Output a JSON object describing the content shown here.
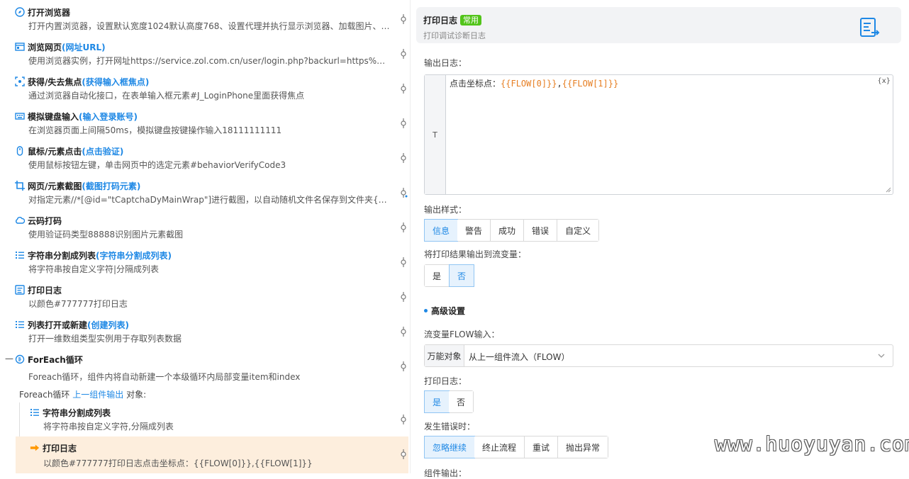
{
  "steps": [
    {
      "icon": "compass-icon",
      "title": "打开浏览器",
      "alias": "",
      "desc": "打开内置浏览器，设置默认宽度1024默认高度768、设置代理并执行显示浏览器、加载图片、…"
    },
    {
      "icon": "browser-window-icon",
      "title": "浏览网页",
      "alias": "(网址URL)",
      "desc": "使用浏览器实例，打开网址https://service.zol.com.cn/user/login.php?backurl=https%3A%2F%…"
    },
    {
      "icon": "focus-icon",
      "title": "获得/失去焦点",
      "alias": "(获得输入框焦点)",
      "desc": "通过浏览器自动化接口，在表单输入框元素#J_LoginPhone里面获得焦点"
    },
    {
      "icon": "keyboard-icon",
      "title": "模拟键盘输入",
      "alias": "(输入登录账号)",
      "desc": "在浏览器页面上间隔50ms，模拟键盘按键操作输入18111111111"
    },
    {
      "icon": "mouse-icon",
      "title": "鼠标/元素点击",
      "alias": "(点击验证)",
      "desc": "使用鼠标按钮左键，单击网页中的选定元素#behaviorVerifyCode3"
    },
    {
      "icon": "crop-icon",
      "title": "网页/元素截图",
      "alias": "(截图打码元素)",
      "desc": "对指定元素//*[@id=\"tCaptchaDyMainWrap\"]进行截图，以自动随机文件名保存到文件夹{{ENV.…"
    },
    {
      "icon": "cloud-icon",
      "title": "云码打码",
      "alias": "",
      "desc": "使用验证码类型88888识别图片元素截图"
    },
    {
      "icon": "list-icon",
      "title": "字符串分割成列表",
      "alias": "(字符串分割成列表)",
      "desc": "将字符串按自定义字符|分隔成列表"
    },
    {
      "icon": "print-log-icon",
      "title": "打印日志",
      "alias": "",
      "desc": "以颜色#777777打印日志"
    },
    {
      "icon": "list-icon",
      "title": "列表打开或新建",
      "alias": "(创建列表)",
      "desc": "打开一维数组类型实例用于存取列表数据"
    },
    {
      "icon": "loop-icon",
      "title": "ForEach循环",
      "alias": "",
      "desc": "Foreach循环，组件内将自动新建一个本级循环内局部变量item和index"
    }
  ],
  "collapse_symbol": "—",
  "foreach_sub": {
    "prefix": "Foreach循环",
    "link": "上一组件输出",
    "suffix": "对象:"
  },
  "nested": [
    {
      "icon": "list-icon",
      "title": "字符串分割成列表",
      "desc": "将字符串按自定义字符,分隔成列表"
    },
    {
      "icon": "arrow-right-icon",
      "title": "打印日志",
      "desc": "以颜色#777777打印日志点击坐标点：{{FLOW[0]}},{{FLOW[1]}}"
    }
  ],
  "panel": {
    "title": "打印日志",
    "badge": "常用",
    "subtitle": "打印调试诊断日志",
    "output_log_label": "输出日志：",
    "log_prefix": "点击坐标点：",
    "log_var1": "{{FLOW[0]}}",
    "log_sep": ",",
    "log_var2": "{{FLOW[1]}}",
    "t_label": "T",
    "x_button": "{x}",
    "style_label": "输出样式：",
    "style_options": [
      "信息",
      "警告",
      "成功",
      "错误",
      "自定义"
    ],
    "style_selected": "信息",
    "to_var_label": "将打印结果输出到流变量：",
    "to_var_options": [
      "是",
      "否"
    ],
    "to_var_selected": "否",
    "advanced_label": "高级设置",
    "flow_input_label": "流变量FLOW输入：",
    "flow_prefix": "万能对象",
    "flow_value": "从上一组件流入（FLOW）",
    "print_log_label": "打印日志：",
    "print_log_options": [
      "是",
      "否"
    ],
    "print_log_selected": "是",
    "on_error_label": "发生错误时：",
    "on_error_options": [
      "忽略继续",
      "终止流程",
      "重试",
      "抛出异常"
    ],
    "on_error_selected": "忽略继续",
    "component_output_label": "组件输出："
  },
  "watermark": "www.huoyuyan.com",
  "colors": {
    "accent": "#1e88e5",
    "badge": "#52c41a",
    "highlight": "#fdeedd",
    "variable": "#e67e22"
  }
}
